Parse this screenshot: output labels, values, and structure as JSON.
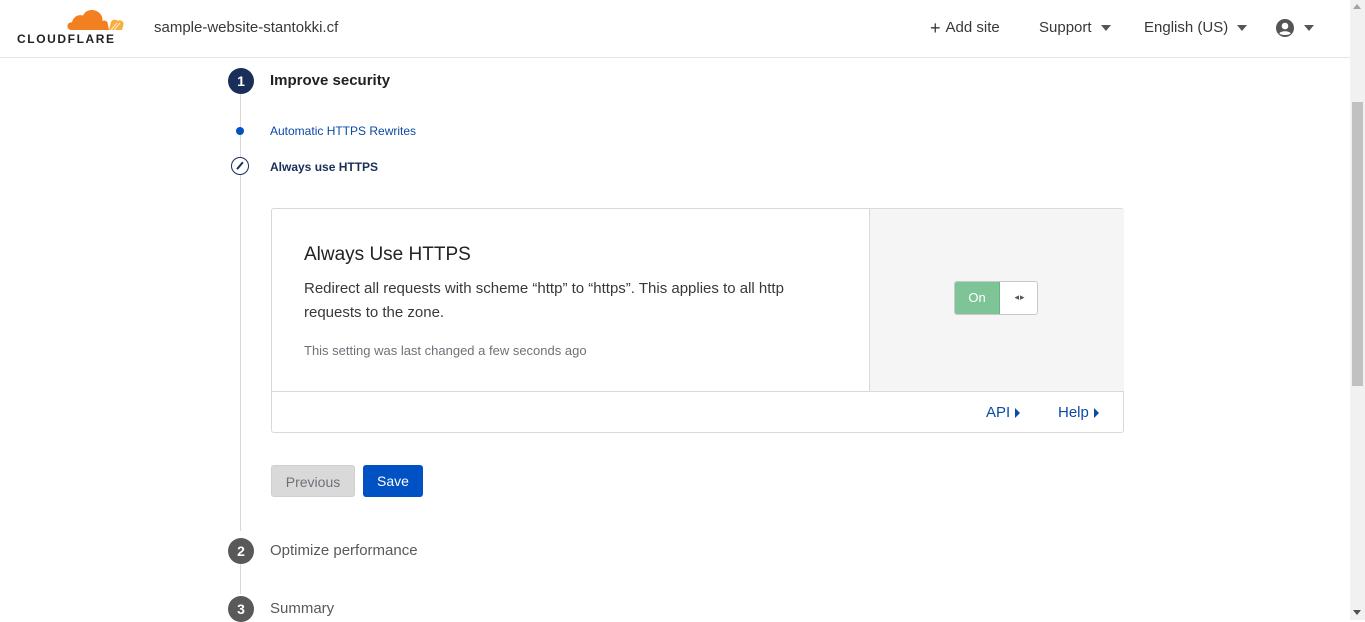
{
  "header": {
    "logo_text": "CLOUDFLARE",
    "site_name": "sample-website-stantokki.cf",
    "add_site_label": "Add site",
    "support_label": "Support",
    "language_label": "English (US)"
  },
  "steps": [
    {
      "number": "1",
      "title": "Improve security",
      "state": "active"
    },
    {
      "number": "2",
      "title": "Optimize performance",
      "state": "pending"
    },
    {
      "number": "3",
      "title": "Summary",
      "state": "pending"
    }
  ],
  "substeps": [
    {
      "label": "Automatic HTTPS Rewrites",
      "state": "done"
    },
    {
      "label": "Always use HTTPS",
      "state": "current"
    }
  ],
  "card": {
    "title": "Always Use HTTPS",
    "description": "Redirect all requests with scheme “http” to “https”. This applies to all http requests to the zone.",
    "note": "This setting was last changed a few seconds ago",
    "toggle_label": "On",
    "toggle_state": true,
    "footer_links": [
      "API",
      "Help"
    ]
  },
  "buttons": {
    "previous": "Previous",
    "save": "Save"
  },
  "colors": {
    "brand_orange": "#f38020",
    "primary_blue": "#0051c3",
    "step_active": "#1a2e5a",
    "toggle_on_green": "#7fc497"
  },
  "icons": [
    "cloud-logo-icon",
    "plus-icon",
    "caret-down-icon",
    "user-account-icon",
    "pencil-icon",
    "triangle-right-icon"
  ]
}
